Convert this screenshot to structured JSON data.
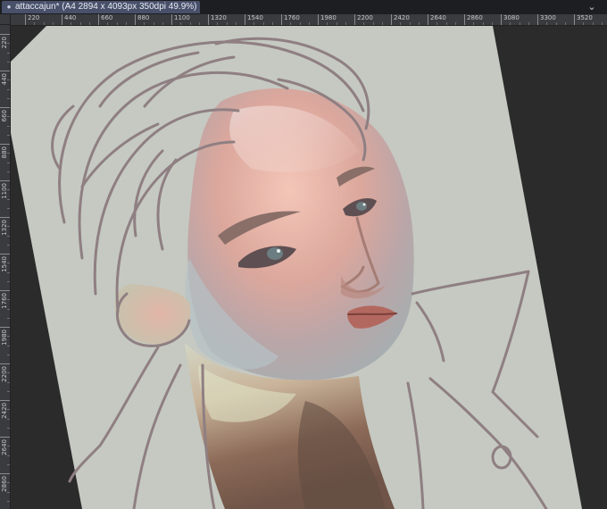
{
  "document": {
    "tab_title": "attaccajun* (A4 2894 x 4093px 350dpi 49.9%)",
    "close_glyph": "●",
    "menu_glyph": "⌄"
  },
  "ruler": {
    "top_labels": [
      "220",
      "440",
      "660",
      "880",
      "1100",
      "1320",
      "1540",
      "1760",
      "1980",
      "2200",
      "2420",
      "2640",
      "2860",
      "3080",
      "3300",
      "3520"
    ],
    "left_labels": [
      "220",
      "440",
      "660",
      "880",
      "1100",
      "1320",
      "1540",
      "1760",
      "1980",
      "2200",
      "2420",
      "2640",
      "2860"
    ]
  },
  "colors": {
    "canvas_paper": "#c5c9c2",
    "sketch_line": "#8f7f82",
    "workspace": "#2b2b2b",
    "tab_active": "#48506a"
  }
}
